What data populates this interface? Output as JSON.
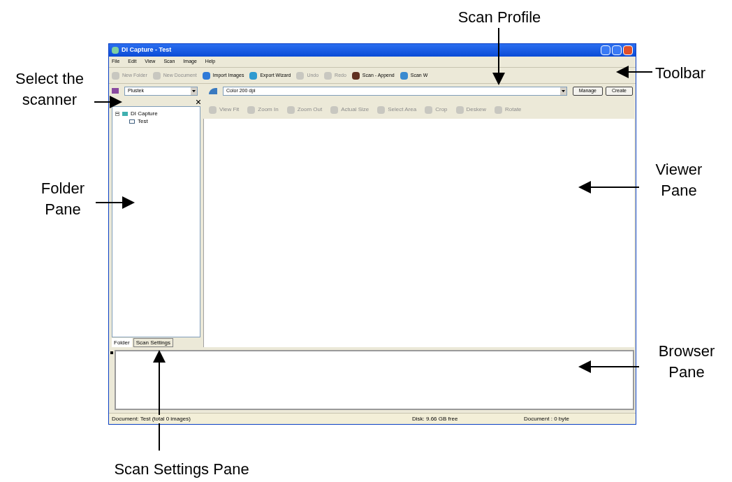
{
  "window": {
    "title": "DI Capture - Test"
  },
  "menu": [
    "File",
    "Edit",
    "View",
    "Scan",
    "Image",
    "Help"
  ],
  "toolbar": [
    {
      "label": "New Folder",
      "disabled": true
    },
    {
      "label": "New Document",
      "disabled": true
    },
    {
      "label": "Import Images",
      "disabled": false
    },
    {
      "label": "Export Wizard",
      "disabled": false
    },
    {
      "label": "Undo",
      "disabled": true
    },
    {
      "label": "Redo",
      "disabled": true
    },
    {
      "label": "Scan - Append",
      "disabled": false
    },
    {
      "label": "Scan W",
      "disabled": false
    }
  ],
  "scanner": {
    "value": "Plustek"
  },
  "scan_profile": {
    "value": "Color 200 dpi"
  },
  "profile_buttons": [
    "Manage",
    "Create"
  ],
  "viewer_toolbar": [
    {
      "label": "View Fit",
      "disabled": true
    },
    {
      "label": "Zoom In",
      "disabled": true
    },
    {
      "label": "Zoom Out",
      "disabled": true
    },
    {
      "label": "Actual Size",
      "disabled": true
    },
    {
      "label": "Select Area",
      "disabled": true
    },
    {
      "label": "Crop",
      "disabled": true
    },
    {
      "label": "Deskew",
      "disabled": true
    },
    {
      "label": "Rotate",
      "disabled": true
    }
  ],
  "folder_tree": [
    {
      "label": "DI Capture",
      "expanded": true,
      "children": [
        {
          "label": "Test"
        }
      ]
    }
  ],
  "pane_tabs": [
    {
      "label": "Folder",
      "selected": true
    },
    {
      "label": "Scan Settings",
      "selected": false
    }
  ],
  "status_bar": [
    "Document: Test (total 0 images)",
    "Disk: 9.66 GB free",
    "Document : 0 byte"
  ],
  "callouts": [
    {
      "label": "Scan Profile"
    },
    {
      "label": "Toolbar"
    },
    {
      "label": "Select the scanner"
    },
    {
      "label": "Folder Pane"
    },
    {
      "label": "Viewer Pane"
    },
    {
      "label": "Browser Pane"
    },
    {
      "label": "Scan Settings Pane"
    }
  ]
}
